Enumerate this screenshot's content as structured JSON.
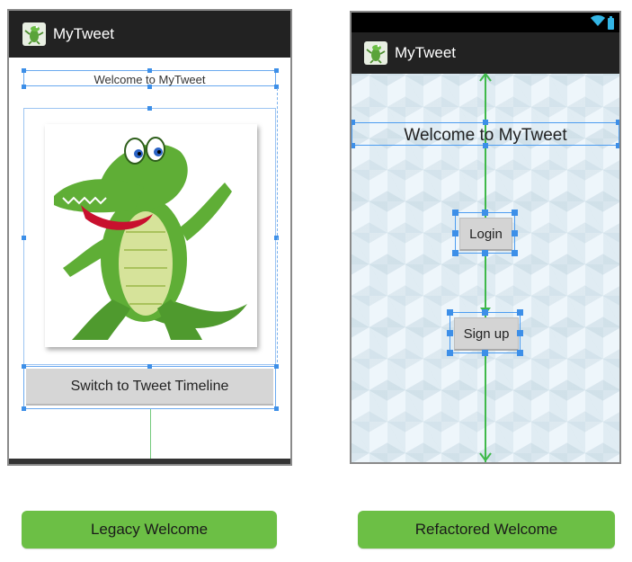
{
  "legacy": {
    "app_title": "MyTweet",
    "welcome_text": "Welcome to MyTweet",
    "switch_button_label": "Switch to Tweet Timeline",
    "caption": "Legacy Welcome"
  },
  "refactored": {
    "app_title": "MyTweet",
    "welcome_text": "Welcome to MyTweet",
    "login_label": "Login",
    "signup_label": "Sign up",
    "caption": "Refactored Welcome"
  },
  "icons": {
    "app_icon": "crocodile-icon",
    "wifi": "wifi-icon",
    "battery": "battery-icon"
  },
  "colors": {
    "actionbar": "#222222",
    "caption_green": "#6cbf45",
    "selection_blue": "#3d8fe8",
    "guide_green": "#3fb94a",
    "status_icon": "#33b5e5"
  }
}
